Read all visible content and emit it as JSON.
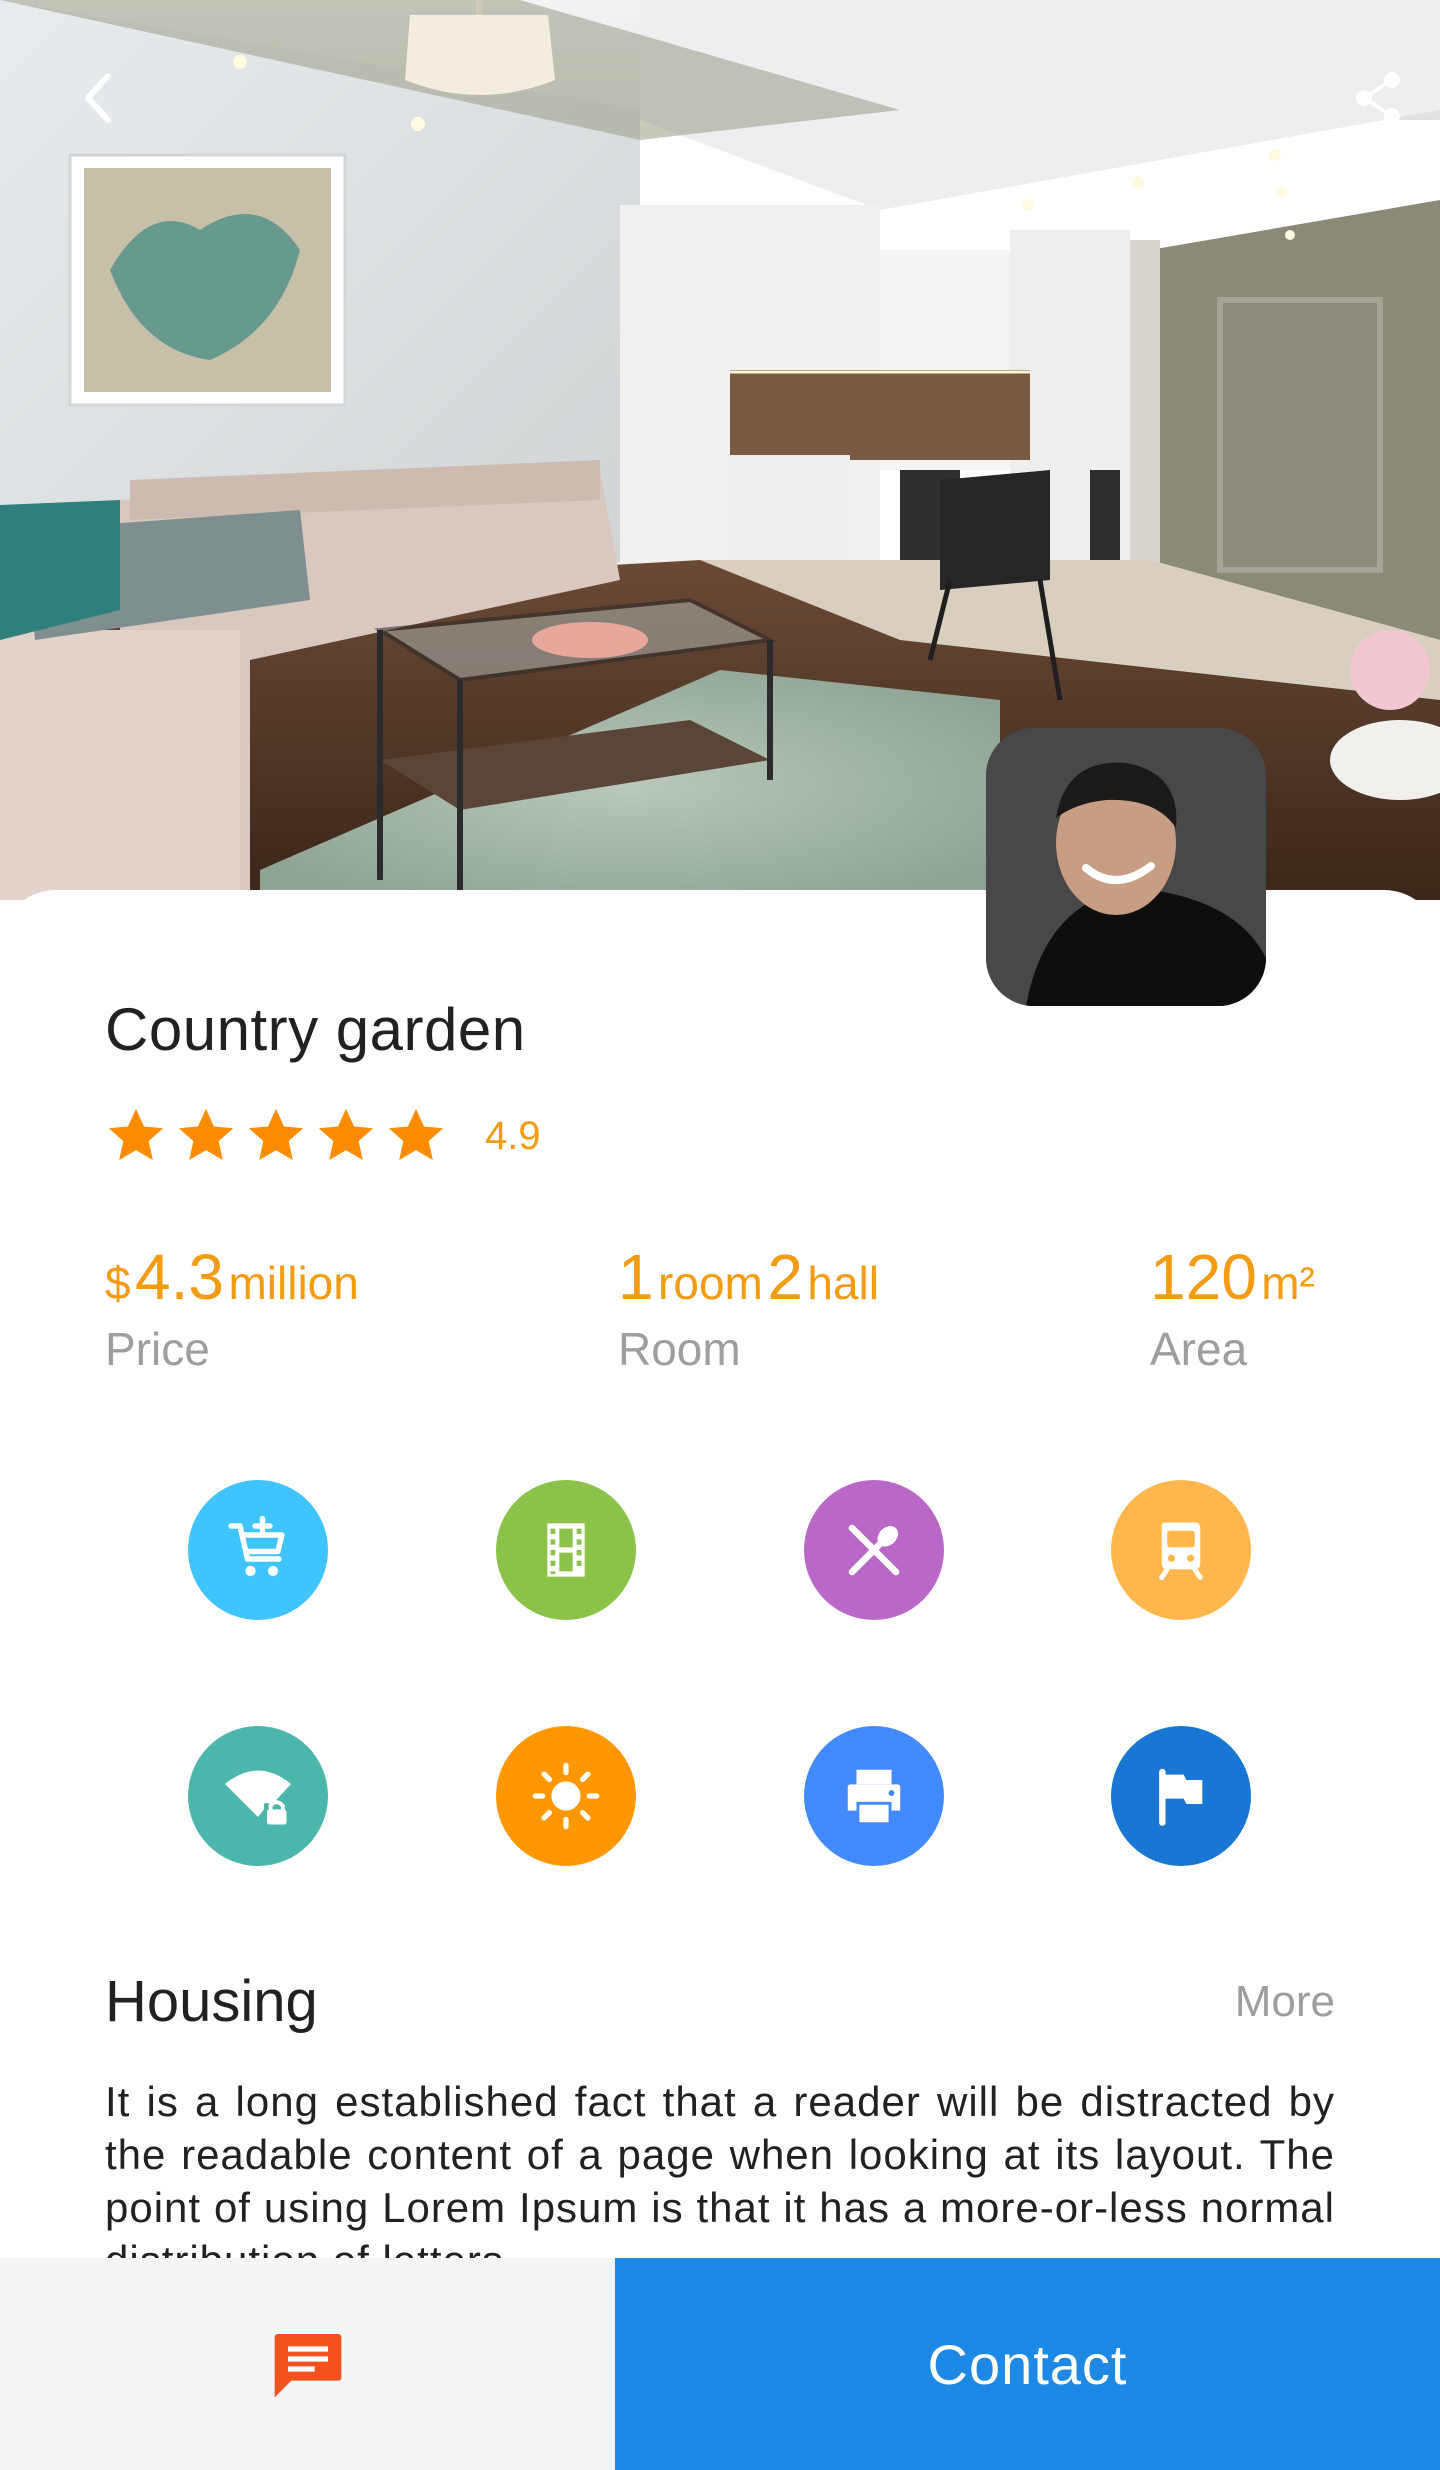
{
  "listing": {
    "title": "Country garden",
    "rating": "4.9",
    "stars": 5
  },
  "stats": {
    "price": {
      "prefix": "$",
      "value": "4.3",
      "unit": "million",
      "label": "Price"
    },
    "room": {
      "rooms": "1",
      "rooms_unit": "room",
      "halls": "2",
      "halls_unit": "hall",
      "label": "Room"
    },
    "area": {
      "value": "120",
      "unit": "m²",
      "label": "Area"
    }
  },
  "amenities": [
    {
      "icon": "cart-add-icon",
      "color": "#40c4ff"
    },
    {
      "icon": "film-icon",
      "color": "#8bc34a"
    },
    {
      "icon": "cutlery-icon",
      "color": "#ba68c8"
    },
    {
      "icon": "train-icon",
      "color": "#ffb74d"
    },
    {
      "icon": "wifi-lock-icon",
      "color": "#4db6ac"
    },
    {
      "icon": "sun-icon",
      "color": "#ff9800"
    },
    {
      "icon": "printer-icon",
      "color": "#448aff"
    },
    {
      "icon": "flag-icon",
      "color": "#1976d2"
    }
  ],
  "housing": {
    "title": "Housing",
    "more": "More",
    "description": "It is a long established fact that a reader will be distracted by the readable content of a page when looking at its layout. The point of using Lorem Ipsum is that it has a more-or-less normal distribution of letters"
  },
  "bottom_bar": {
    "contact_label": "Contact",
    "chat_icon": "chat-icon",
    "chat_color": "#f4511e",
    "contact_color": "#1e88e5"
  },
  "colors": {
    "accent": "#f39c12",
    "muted": "#9e9e9e"
  }
}
